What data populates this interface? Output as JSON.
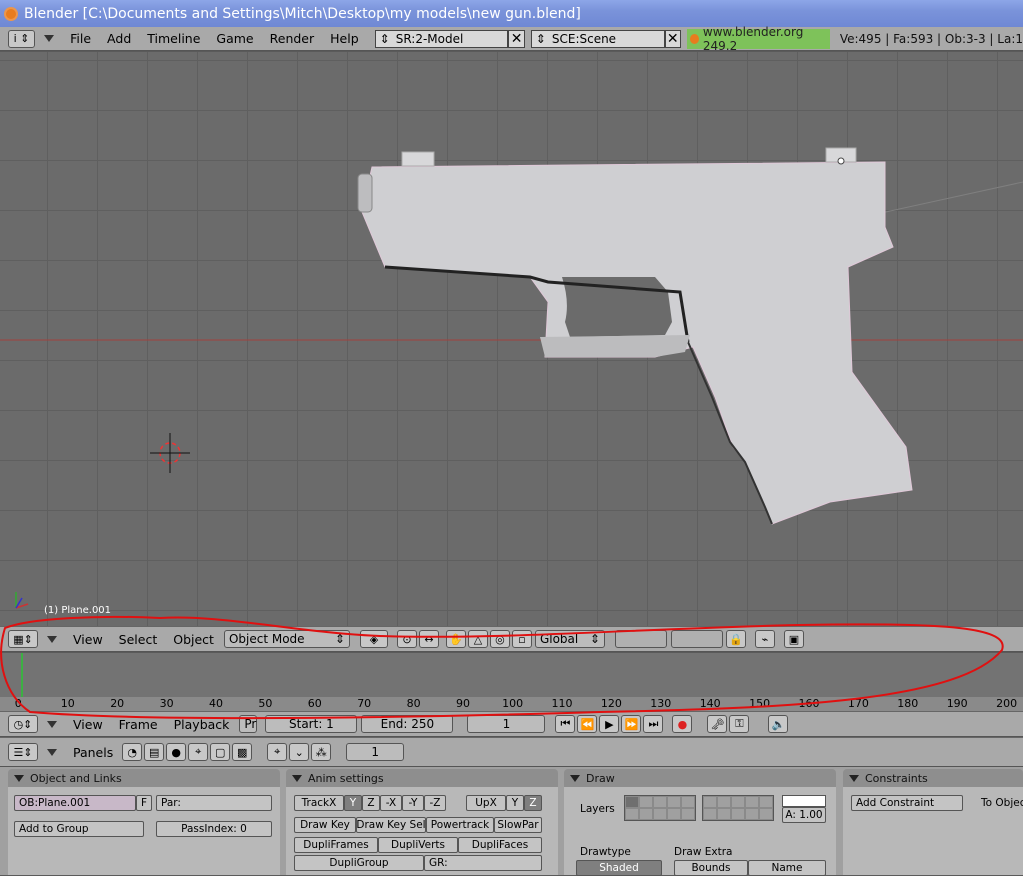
{
  "window": {
    "title": "Blender [C:\\Documents and Settings\\Mitch\\Desktop\\my models\\new gun.blend]"
  },
  "menubar": {
    "items": [
      "File",
      "Add",
      "Timeline",
      "Game",
      "Render",
      "Help"
    ],
    "screen": "SR:2-Model",
    "scene": "SCE:Scene",
    "link": "www.blender.org 249.2",
    "stats": "Ve:495 | Fa:593 | Ob:3-3 | La:1"
  },
  "viewport": {
    "object_label": "(1) Plane.001"
  },
  "view_header": {
    "menus": [
      "View",
      "Select",
      "Object"
    ],
    "mode": "Object Mode",
    "orientation": "Global"
  },
  "timeline": {
    "ticks": [
      "0",
      "10",
      "20",
      "30",
      "40",
      "50",
      "60",
      "70",
      "80",
      "90",
      "100",
      "110",
      "120",
      "130",
      "140",
      "150",
      "160",
      "170",
      "180",
      "190",
      "200"
    ],
    "current_frame_marker": 1
  },
  "timeline_header": {
    "menus": [
      "View",
      "Frame",
      "Playback"
    ],
    "pr": "Pr",
    "start": "Start: 1",
    "end": "End: 250",
    "frame": "1"
  },
  "buttons_header": {
    "panels": "Panels",
    "frame": "1"
  },
  "panels": {
    "object_links": {
      "title": "Object and Links",
      "ob": "OB:Plane.001",
      "f": "F",
      "par": "Par:",
      "add_group": "Add to Group",
      "pass_index": "PassIndex: 0"
    },
    "anim": {
      "title": "Anim settings",
      "track": [
        "TrackX",
        "Y",
        "Z",
        "-X",
        "-Y",
        "-Z"
      ],
      "up": [
        "UpX",
        "Y",
        "Z"
      ],
      "row2": [
        "Draw Key",
        "Draw Key Sel",
        "Powertrack",
        "SlowPar"
      ],
      "row3": [
        "DupliFrames",
        "DupliVerts",
        "DupliFaces"
      ],
      "dupligroup": "DupliGroup",
      "gr": "GR:"
    },
    "draw": {
      "title": "Draw",
      "layers": "Layers",
      "alpha": "A: 1.00",
      "drawtype": "Drawtype",
      "drawextra": "Draw Extra",
      "shaded": "Shaded",
      "bounds": "Bounds",
      "name": "Name"
    },
    "constraints": {
      "title": "Constraints",
      "add": "Add Constraint",
      "to": "To Objec"
    }
  },
  "colors": {
    "timeline_cursor": "#3cb043",
    "annotation": "#e01010",
    "link_bg": "#7ec25a"
  }
}
